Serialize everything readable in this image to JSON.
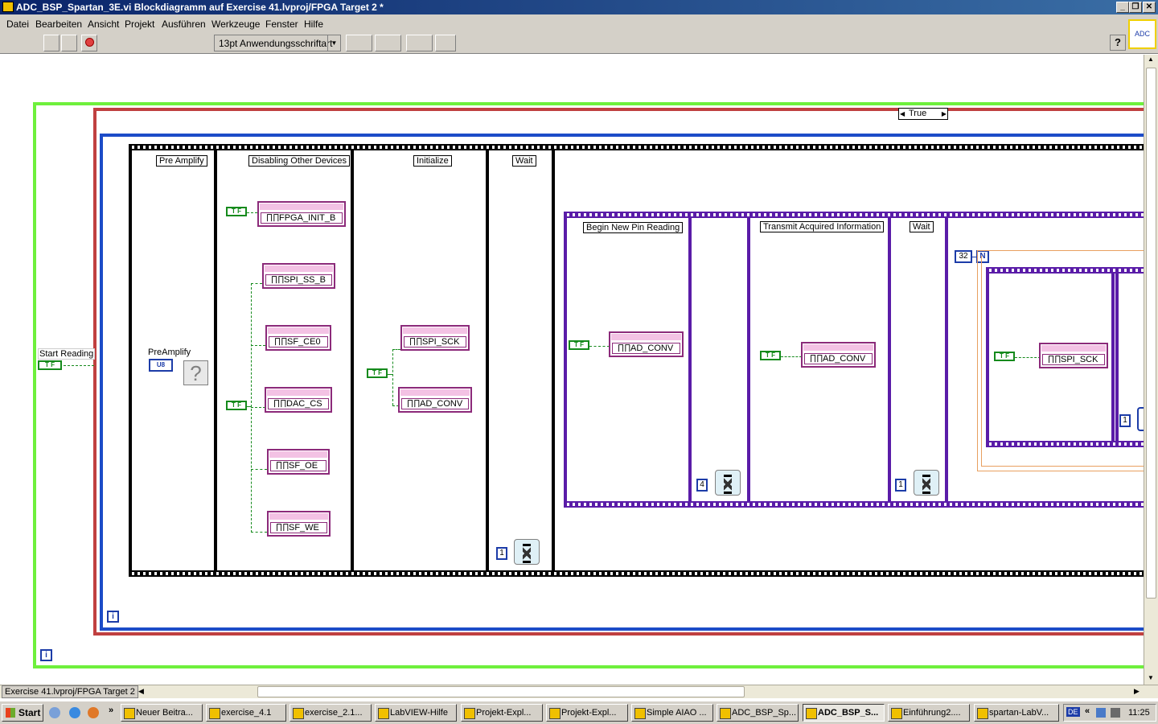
{
  "window": {
    "title": "ADC_BSP_Spartan_3E.vi Blockdiagramm auf Exercise 41.lvproj/FPGA Target 2 *",
    "controls": {
      "minimize": "_",
      "restore": "❐",
      "close": "✕"
    }
  },
  "menu": [
    {
      "label": "Datei"
    },
    {
      "label": "Bearbeiten"
    },
    {
      "label": "Ansicht"
    },
    {
      "label": "Projekt"
    },
    {
      "label": "Ausführen"
    },
    {
      "label": "Werkzeuge"
    },
    {
      "label": "Fenster"
    },
    {
      "label": "Hilfe"
    }
  ],
  "toolbar": {
    "font": "13pt Anwendungsschriftart",
    "help": "?",
    "vi_icon_text": "ADC"
  },
  "diagram": {
    "case_selector": "True",
    "start_reading_label": "Start Reading",
    "start_reading_const": "T F",
    "preamplify_label": "PreAmplify",
    "preamplify_type": "U8",
    "outer_frames": [
      "Pre Amplify",
      "Disabling Other Devices",
      "Initialize",
      "Wait"
    ],
    "inner_frames": [
      "Begin New Pin Reading",
      "Transmit Acquired Information",
      "Wait"
    ],
    "nodes": {
      "fpga_init": "FPGA_INIT_B",
      "spi_ss": "SPI_SS_B",
      "sf_ce0": "SF_CE0",
      "dac_cs": "DAC_CS",
      "sf_oe": "SF_OE",
      "sf_we": "SF_WE",
      "init_spi_sck": "SPI_SCK",
      "init_ad_conv": "AD_CONV",
      "begin_ad_conv": "AD_CONV",
      "transmit_ad_conv": "AD_CONV",
      "loop_spi_sck": "SPI_SCK"
    },
    "bool_const": "T F",
    "constants": {
      "wait_outer": "1",
      "wait_mid": "4",
      "wait_inner": "1",
      "loop_count": "32",
      "loop_n": "N",
      "loop_one": "1"
    },
    "iteration_label": "i"
  },
  "statusbar": {
    "path": "Exercise 41.lvproj/FPGA Target 2"
  },
  "taskbar": {
    "start": "Start",
    "tasks": [
      {
        "label": "Neuer Beitra..."
      },
      {
        "label": "exercise_4.1"
      },
      {
        "label": "exercise_2.1..."
      },
      {
        "label": "LabVIEW-Hilfe"
      },
      {
        "label": "Projekt-Expl..."
      },
      {
        "label": "Projekt-Expl..."
      },
      {
        "label": "Simple AIAO ..."
      },
      {
        "label": "ADC_BSP_Sp..."
      },
      {
        "label": "ADC_BSP_S..."
      },
      {
        "label": "Einführung2...."
      },
      {
        "label": "spartan-LabV..."
      }
    ],
    "lang": "DE",
    "chevron": "«",
    "clock": "11:25"
  }
}
